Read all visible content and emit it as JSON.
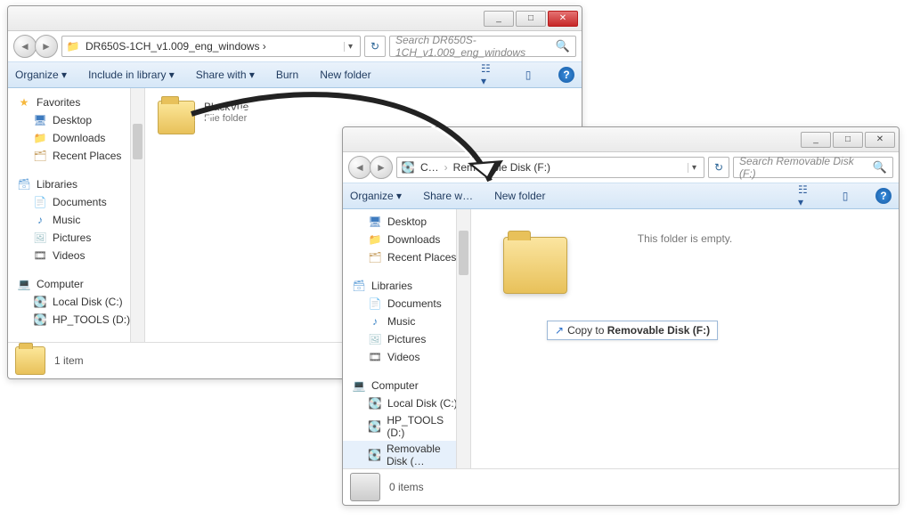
{
  "win1": {
    "title_controls": {
      "min": "_",
      "max": "□",
      "close": "✕"
    },
    "address": "DR650S-1CH_v1.009_eng_windows  ›",
    "search_placeholder": "Search DR650S-1CH_v1.009_eng_windows",
    "toolbar": {
      "organize": "Organize ▾",
      "include": "Include in library ▾",
      "share": "Share with ▾",
      "burn": "Burn",
      "newfolder": "New folder"
    },
    "sidebar": {
      "favorites": "Favorites",
      "desktop": "Desktop",
      "downloads": "Downloads",
      "recent": "Recent Places",
      "libraries": "Libraries",
      "documents": "Documents",
      "music": "Music",
      "pictures": "Pictures",
      "videos": "Videos",
      "computer": "Computer",
      "localc": "Local Disk (C:)",
      "hpd": "HP_TOOLS (D:)"
    },
    "file": {
      "name": "BlackVue",
      "type": "File folder"
    },
    "status": "1 item"
  },
  "win2": {
    "title_controls": {
      "min": "_",
      "max": "□",
      "close": "✕"
    },
    "address_left": "C…",
    "address_main": "Removable Disk (F:)",
    "search_placeholder": "Search Removable Disk (F:)",
    "toolbar": {
      "organize": "Organize ▾",
      "share": "Share w…",
      "newfolder": "New folder"
    },
    "sidebar": {
      "desktop": "Desktop",
      "downloads": "Downloads",
      "recent": "Recent Places",
      "libraries": "Libraries",
      "documents": "Documents",
      "music": "Music",
      "pictures": "Pictures",
      "videos": "Videos",
      "computer": "Computer",
      "localc": "Local Disk (C:)",
      "hpd": "HP_TOOLS (D:)",
      "removable": "Removable Disk (…"
    },
    "empty": "This folder is empty.",
    "status": "0 items"
  },
  "drag": {
    "tooltip_prefix": "Copy to ",
    "tooltip_dest": "Removable Disk (F:)"
  }
}
